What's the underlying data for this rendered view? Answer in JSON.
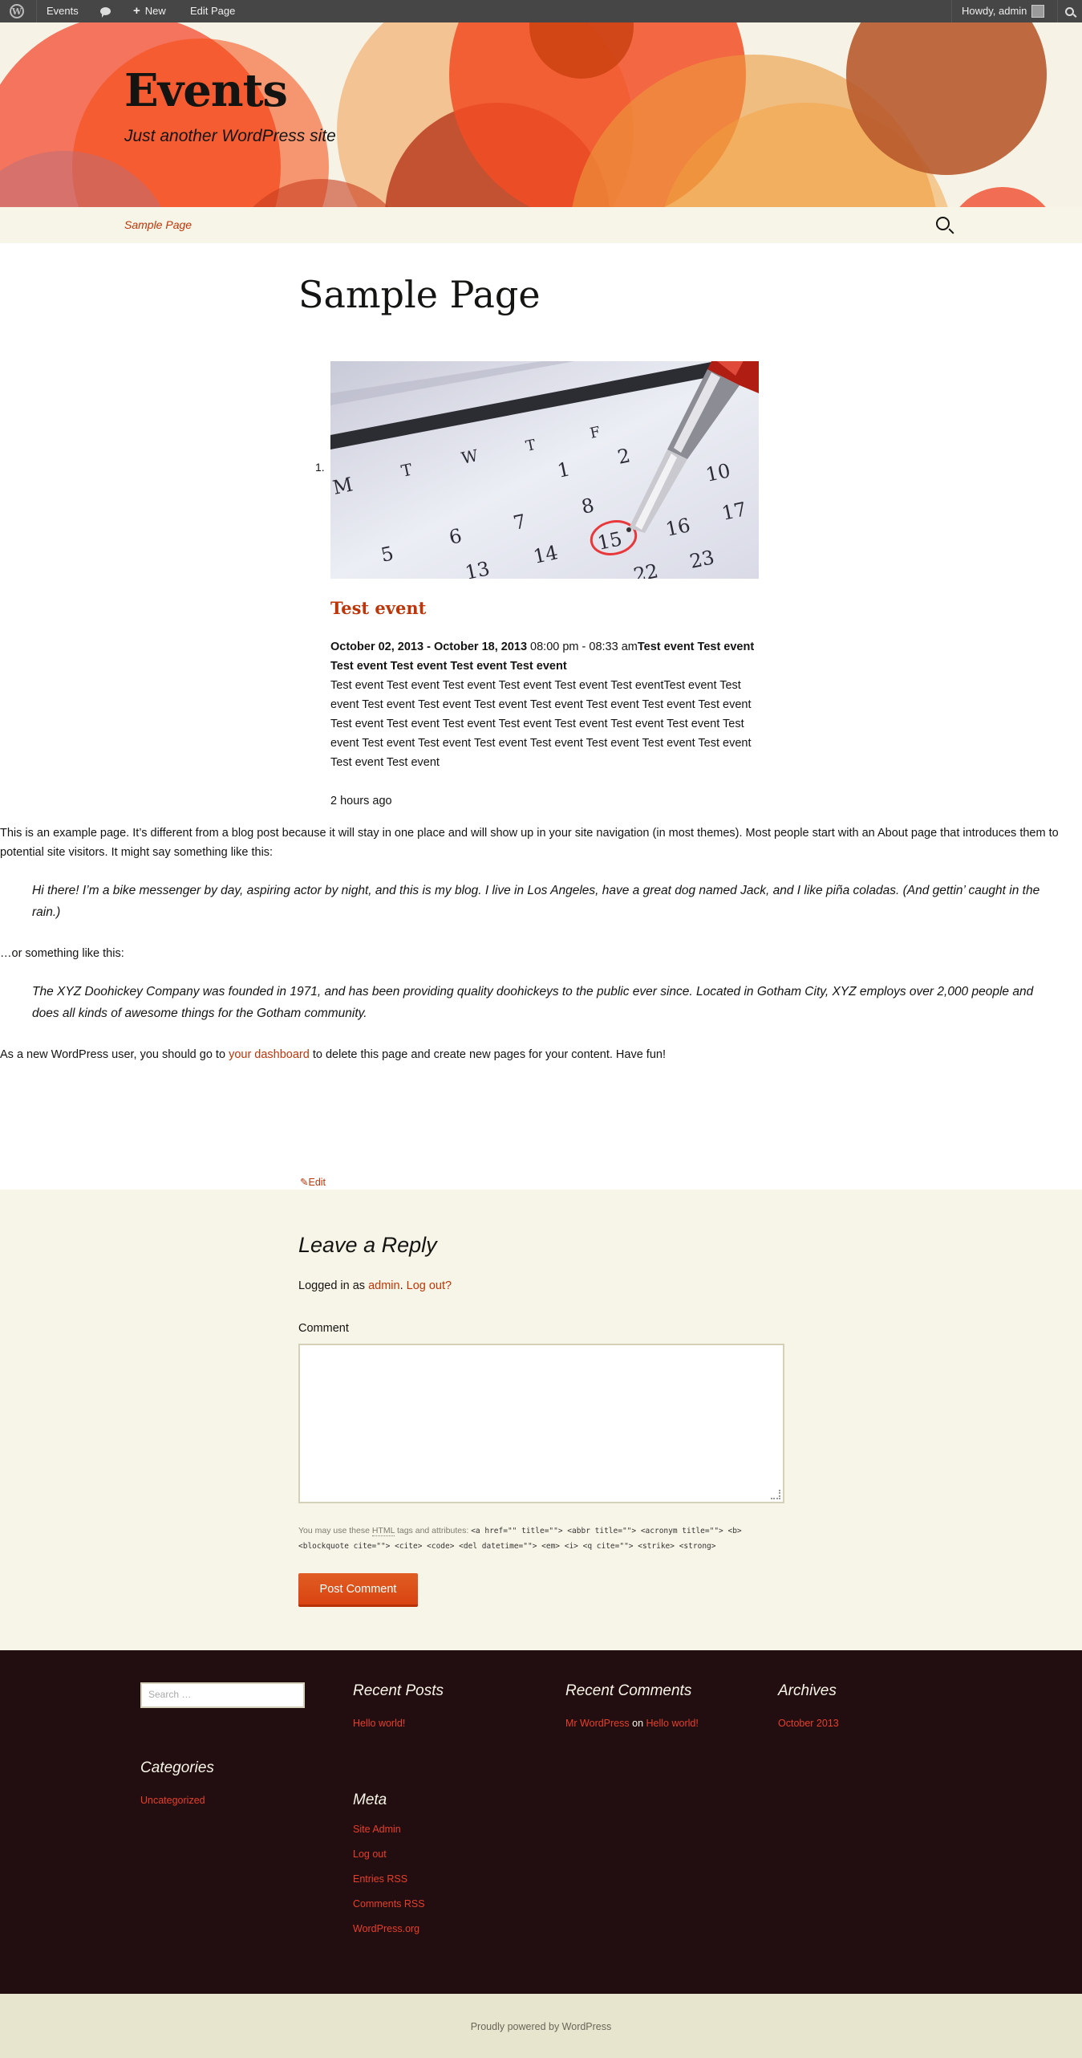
{
  "adminbar": {
    "site_name": "Events",
    "new_label": "New",
    "edit_page": "Edit Page",
    "howdy": "Howdy, admin"
  },
  "header": {
    "title": "Events",
    "description": "Just another WordPress site"
  },
  "nav": {
    "item": "Sample Page"
  },
  "page": {
    "title": "Sample Page"
  },
  "event": {
    "number": "1.",
    "title": "Test event",
    "dates": "October 02, 2013 - October 18, 2013",
    "times": "08:00 pm - 08:33 am",
    "subtitle_a": "Test event Test event",
    "subtitle_b": "Test event Test event Test event Test event",
    "desc_lines": [
      "Test event Test event Test event Test event Test event Test eventTest event Test",
      "event Test event Test event Test event Test event Test event Test event Test event",
      "Test event Test event Test event Test event Test event Test event Test event Test",
      "event Test event Test event Test event Test event Test event Test event Test event",
      "Test event Test event"
    ],
    "ago": "2 hours ago"
  },
  "content": {
    "intro": "This is an example page. It’s different from a blog post because it will stay in one place and will show up in your site navigation (in most themes). Most people start with an About page that introduces them to potential site visitors. It might say something like this:",
    "quote1": "Hi there! I’m a bike messenger by day, aspiring actor by night, and this is my blog. I live in Los Angeles, have a great dog named Jack, and I like piña coladas. (And gettin’ caught in the rain.)",
    "or_text": "…or something like this:",
    "quote2": "The XYZ Doohickey Company was founded in 1971, and has been providing quality doohickeys to the public ever since. Located in Gotham City, XYZ employs over 2,000 people and does all kinds of awesome things for the Gotham community.",
    "outro_before": "As a new WordPress user, you should go to ",
    "outro_link": "your dashboard",
    "outro_after": " to delete this page and create new pages for your content. Have fun!",
    "edit": "Edit"
  },
  "reply": {
    "title": "Leave a Reply",
    "logged_in_prefix": "Logged in as ",
    "user": "admin",
    "period": ". ",
    "logout": "Log out?",
    "comment_label": "Comment",
    "comment_value": "",
    "allowed_prefix": "You may use these ",
    "allowed_html": "HTML",
    "allowed_mid": " tags and attributes: ",
    "allowed_code1": "<a href=\"\" title=\"\"> <abbr title=\"\"> <acronym title=\"\"> <b>",
    "allowed_code2": "<blockquote cite=\"\"> <cite> <code> <del datetime=\"\"> <em> <i> <q cite=\"\"> <strike> <strong>",
    "submit": "Post Comment"
  },
  "footer": {
    "search_placeholder": "Search …",
    "recent_posts_title": "Recent Posts",
    "recent_post": "Hello world!",
    "recent_comments_title": "Recent Comments",
    "comment_author": "Mr WordPress",
    "comment_on": "on",
    "comment_post": "Hello world!",
    "archives_title": "Archives",
    "archive": "October 2013",
    "categories_title": "Categories",
    "category": "Uncategorized",
    "meta_title": "Meta",
    "meta_links": [
      "Site Admin",
      "Log out",
      "Entries RSS",
      "Comments RSS",
      "WordPress.org"
    ],
    "powered": "Proudly powered by WordPress"
  }
}
